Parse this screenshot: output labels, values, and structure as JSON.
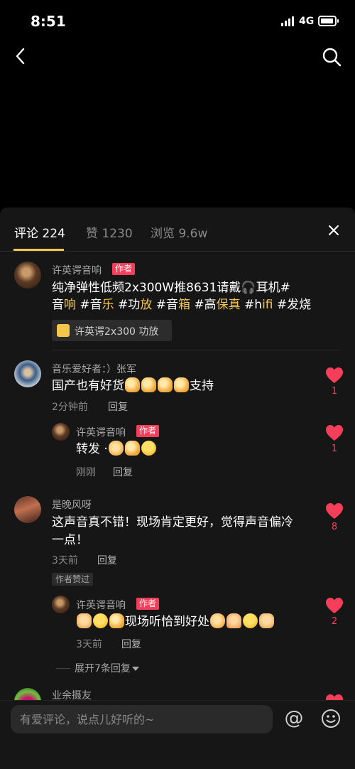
{
  "status": {
    "time": "8:51",
    "network": "4G"
  },
  "tabs": [
    {
      "label": "评论 224"
    },
    {
      "label": "赞 1230"
    },
    {
      "label": "浏览 9.6w"
    }
  ],
  "author_label": "作者",
  "post": {
    "author": "许英谔音响",
    "text_line1": "纯净弹性低频2x300W推8631请戴🎧耳机#",
    "line2": [
      "音",
      "响",
      " #音",
      "乐",
      " #功",
      "放",
      " #音",
      "箱",
      " #高",
      "保真",
      " #h",
      "ifi",
      " #发烧"
    ],
    "product_label": "许英谔2x300 功放"
  },
  "comments": [
    {
      "user": "音乐爱好者：）张军",
      "text": "国产也有好货",
      "suffix": "支持",
      "time": "2分钟前",
      "reply_label": "回复",
      "likes": "1",
      "reply": {
        "user": "许英谔音响",
        "text": "转发 ·",
        "time": "刚刚",
        "reply_label": "回复",
        "likes": "1"
      }
    },
    {
      "user": "是晚风呀",
      "text_line1": "这声音真不错！现场肯定更好，觉得声音偏冷",
      "text_line2": "一点！",
      "time": "3天前",
      "reply_label": "回复",
      "likes": "8",
      "praised_badge": "作者赞过",
      "reply": {
        "user": "许英谔音响",
        "text": "现场听恰到好处",
        "time": "3天前",
        "reply_label": "回复",
        "likes": "2"
      },
      "expand_label": "展开7条回复"
    },
    {
      "user": "业余摄友"
    }
  ],
  "composer": {
    "placeholder": "有爱评论，说点儿好听的~",
    "at_symbol": "@"
  },
  "colors": {
    "accent": "#f4c64c",
    "like": "#f53e5a",
    "panel": "#161616"
  }
}
